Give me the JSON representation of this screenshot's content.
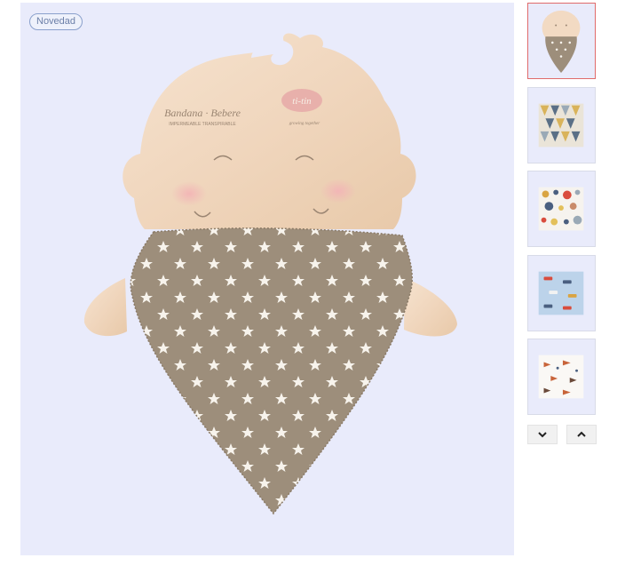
{
  "badge": {
    "label": "Novedad"
  },
  "product_image": {
    "card_title": "Bandana · Bebere",
    "card_subtitle": "IMPERMEABLE TRANSPIRABLE",
    "brand": "ti-tin",
    "brand_tagline": "growing together"
  },
  "thumbnails": [
    {
      "pattern": "stars",
      "selected": true
    },
    {
      "pattern": "triangles",
      "selected": false
    },
    {
      "pattern": "dots",
      "selected": false
    },
    {
      "pattern": "cars",
      "selected": false
    },
    {
      "pattern": "foxes",
      "selected": false
    }
  ],
  "nav": {
    "down_icon": "chevron-down-icon",
    "up_icon": "chevron-up-icon"
  },
  "colors": {
    "bandana": "#9d8e7b",
    "card": "#f3dcc5",
    "background": "#e9ebfb",
    "selected_border": "#e06b6b"
  }
}
